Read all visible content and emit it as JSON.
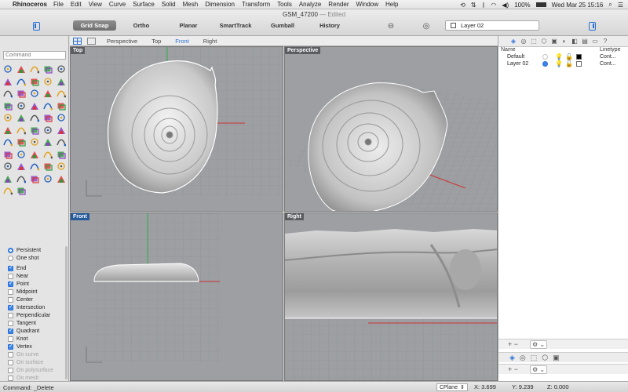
{
  "menubar": {
    "apple": "",
    "app": "Rhinoceros",
    "items": [
      "File",
      "Edit",
      "View",
      "Curve",
      "Surface",
      "Solid",
      "Mesh",
      "Dimension",
      "Transform",
      "Tools",
      "Analyze",
      "Render",
      "Window",
      "Help"
    ],
    "battery": "100%",
    "clock": "Wed Mar 25  15:16"
  },
  "window": {
    "title": "GSM_47200",
    "edited": "— Edited"
  },
  "toolbar": {
    "grid_snap": "Grid Snap",
    "ortho": "Ortho",
    "planar": "Planar",
    "smarttrack": "SmartTrack",
    "gumball": "Gumball",
    "history": "History",
    "current_layer": "Layer 02",
    "layer_color": "#ffffff"
  },
  "command": {
    "placeholder": "Command",
    "last": "Command: _Delete"
  },
  "tools": [
    "point-icon",
    "points-icon",
    "line-icon",
    "polyline-icon",
    "curve-icon",
    "circle-icon",
    "arc-icon",
    "ellipse-icon",
    "rectangle-icon",
    "polygon-icon",
    "fillet-icon",
    "offset-icon",
    "extend-icon",
    "surface-icon",
    "revolve-icon",
    "loft-icon",
    "sweep-icon",
    "box-icon",
    "sphere-icon",
    "cylinder-icon",
    "boolean-icon",
    "explode-icon",
    "join-icon",
    "trim-icon",
    "split-icon",
    "move-icon",
    "copy-icon",
    "rotate-icon",
    "scale-icon",
    "mirror-icon",
    "array-icon",
    "align-icon",
    "group-icon",
    "check-icon",
    "dimension-icon",
    "text-icon",
    "hatch-icon",
    "layer-icon",
    "cplane-icon",
    "named-view-icon",
    "analyze-icon",
    "curvature-icon",
    "zebra-icon",
    "light-icon",
    "render-icon",
    "material-icon",
    "color-wheel-icon",
    "camera-icon",
    "sun-icon",
    "environment-icon",
    "globe-icon",
    "move-grip-icon"
  ],
  "osnap": {
    "modes": [
      {
        "label": "Persistent",
        "type": "radio",
        "on": true
      },
      {
        "label": "One shot",
        "type": "radio",
        "on": false
      }
    ],
    "items": [
      {
        "label": "End",
        "on": true,
        "disabled": false
      },
      {
        "label": "Near",
        "on": false,
        "disabled": false
      },
      {
        "label": "Point",
        "on": true,
        "disabled": false
      },
      {
        "label": "Midpoint",
        "on": false,
        "disabled": false
      },
      {
        "label": "Center",
        "on": false,
        "disabled": false
      },
      {
        "label": "Intersection",
        "on": true,
        "disabled": false
      },
      {
        "label": "Perpendicular",
        "on": false,
        "disabled": false
      },
      {
        "label": "Tangent",
        "on": false,
        "disabled": false
      },
      {
        "label": "Quadrant",
        "on": true,
        "disabled": false
      },
      {
        "label": "Knot",
        "on": false,
        "disabled": false
      },
      {
        "label": "Vertex",
        "on": true,
        "disabled": false
      },
      {
        "label": "On curve",
        "on": false,
        "disabled": true
      },
      {
        "label": "On surface",
        "on": false,
        "disabled": true
      },
      {
        "label": "On polysurface",
        "on": false,
        "disabled": true
      },
      {
        "label": "On mesh",
        "on": false,
        "disabled": true
      }
    ]
  },
  "viewport_tabs": [
    "Perspective",
    "Top",
    "Front",
    "Right"
  ],
  "active_tab": "Front",
  "viewports": {
    "top": "Top",
    "perspective": "Perspective",
    "front": "Front",
    "right": "Right"
  },
  "layers": {
    "col_name": "Name",
    "col_linetype": "Linetype",
    "rows": [
      {
        "name": "Default",
        "current": false,
        "color": "#000000",
        "linetype": "Cont..."
      },
      {
        "name": "Layer 02",
        "current": true,
        "color": "#ffffff",
        "linetype": "Cont..."
      }
    ]
  },
  "status": {
    "cplane": "CPlane",
    "x": "X: 3.699",
    "y": "Y: 9.239",
    "z": "Z: 0.000"
  }
}
